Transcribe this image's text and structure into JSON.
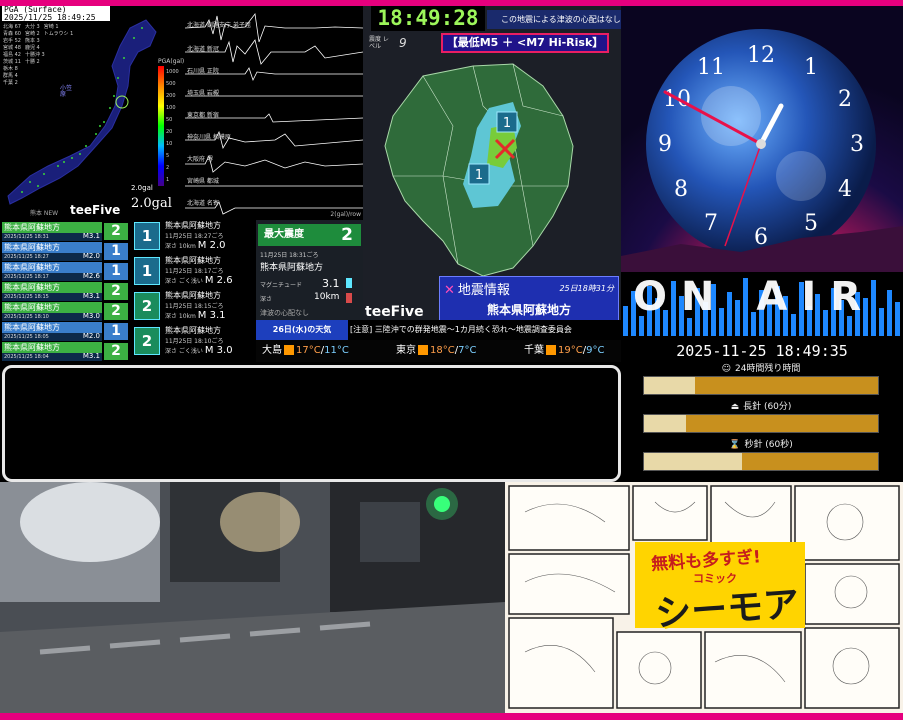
{
  "pga": {
    "header_line1": "PGA (Surface)",
    "header_line2": "2025/11/25 18:49:25",
    "stations": [
      [
        "北海 67",
        "大分 3",
        "宮崎 1"
      ],
      [
        "青森 60",
        "宮崎 2",
        "トムラウシ 1"
      ],
      [
        "岩手 52",
        "熊本 3",
        ""
      ],
      [
        "宮城 48",
        "鹿児 4",
        ""
      ],
      [
        "福島 42",
        "十勝沖 3",
        ""
      ],
      [
        "茨城 11",
        "十勝 2",
        ""
      ],
      [
        "栃木 8",
        "",
        ""
      ],
      [
        "群馬 4",
        "",
        ""
      ],
      [
        "千葉 2",
        "",
        ""
      ]
    ],
    "map_note": "小笠原",
    "scale_title": "PGA(gal)",
    "scale_ticks": [
      "1000",
      "500",
      "200",
      "100",
      "50",
      "20",
      "10",
      "5",
      "2",
      "1"
    ],
    "gal_small": "2.0gal",
    "gal_big": "2.0gal"
  },
  "seis": {
    "stations": [
      "北海道 釧路支庁 弟子屈",
      "北海道 新冠",
      "石川県 正院",
      "埼玉県 岩槻",
      "東京都 新宿",
      "神奈川県 相模原",
      "大阪府 堺",
      "宮崎県 都城",
      "北海道 名寄"
    ],
    "unit": "2(gal)/row"
  },
  "quake": {
    "clock_time": "18:49:28",
    "tsunami": "この地震による津波の心配はなし",
    "shindo_label": "震度 レベル",
    "shindo_level": "9",
    "risk_banner": "【最低M5 ＋ <M7 Hi-Risk】",
    "brand": "teeFive",
    "info_title": "地震情報",
    "info_time": "25日18時31分",
    "info_region": "熊本県阿蘇地方",
    "map_intensity": [
      "1",
      "1"
    ]
  },
  "onair": {
    "label": "ON AIR"
  },
  "datetime": "2025-11-25 18:49:35",
  "timers": [
    {
      "icon": "☺",
      "label": "24時間残り時間",
      "fraction": 0.22
    },
    {
      "icon": "⏏",
      "label": "長針 (60分)",
      "fraction": 0.18
    },
    {
      "icon": "⌛",
      "label": "秒針 (60秒)",
      "fraction": 0.42
    }
  ],
  "intensity_list": {
    "header": "熊本 NEW",
    "brand": "teeFive",
    "rows": [
      {
        "name": "熊本県阿蘇地方",
        "time": "2025/11/25 18:31",
        "mag": "M3.1",
        "level": "2",
        "color": "#3cb043"
      },
      {
        "name": "熊本県阿蘇地方",
        "time": "2025/11/25 18:27",
        "mag": "M2.0",
        "level": "1",
        "color": "#3a7ecb"
      },
      {
        "name": "熊本県阿蘇地方",
        "time": "2025/11/25 18:17",
        "mag": "M2.6",
        "level": "1",
        "color": "#3a7ecb"
      },
      {
        "name": "熊本県阿蘇地方",
        "time": "2025/11/25 18:15",
        "mag": "M3.1",
        "level": "2",
        "color": "#3cb043"
      },
      {
        "name": "熊本県阿蘇地方",
        "time": "2025/11/25 18:10",
        "mag": "M3.0",
        "level": "2",
        "color": "#3cb043"
      },
      {
        "name": "熊本県阿蘇地方",
        "time": "2025/11/25 18:05",
        "mag": "M2.0",
        "level": "1",
        "color": "#3a7ecb"
      },
      {
        "name": "熊本県阿蘇地方",
        "time": "2025/11/25 18:04",
        "mag": "M3.1",
        "level": "2",
        "color": "#3cb043"
      }
    ]
  },
  "center_list": {
    "rows": [
      {
        "level": "1",
        "title": "熊本県阿蘇地方",
        "time": "11月25日 18:27ごろ",
        "depth": "深さ 10km",
        "mag": "M 2.0"
      },
      {
        "level": "1",
        "title": "熊本県阿蘇地方",
        "time": "11月25日 18:17ごろ",
        "depth": "深さ ごく浅い",
        "mag": "M 2.6"
      },
      {
        "level": "2",
        "title": "熊本県阿蘇地方",
        "time": "11月25日 18:15ごろ",
        "depth": "深さ 10km",
        "mag": "M 3.1"
      },
      {
        "level": "2",
        "title": "熊本県阿蘇地方",
        "time": "11月25日 18:10ごろ",
        "depth": "深さ ごく浅い",
        "mag": "M 3.0"
      }
    ]
  },
  "detail": {
    "max_label": "最大震度",
    "max_value": "2",
    "datetime": "11月25日 18:31ごろ",
    "region": "熊本県阿蘇地方",
    "mag_label": "マグニチュード",
    "mag_value": "3.1",
    "depth_label": "深さ",
    "depth_value": "10km",
    "tsunami": "津波の心配なし"
  },
  "ticker": {
    "day": "26日(水)の天気",
    "message": "[注意] 三陸沖での群発地震〜1カ月続く恐れ〜地震調査委員会"
  },
  "weather": [
    {
      "city": "大島",
      "hi": "17°C",
      "lo": "11°C"
    },
    {
      "city": "東京",
      "hi": "18°C",
      "lo": "7°C"
    },
    {
      "city": "千葉",
      "hi": "19°C",
      "lo": "9°C"
    }
  ],
  "manga": {
    "headline": "無料も多すぎ!",
    "comic": "コミック",
    "brand": "シーモア"
  },
  "colors": {
    "frame": "#e6007e",
    "time_green": "#9cf55a",
    "risk_border": "#e91e63"
  }
}
